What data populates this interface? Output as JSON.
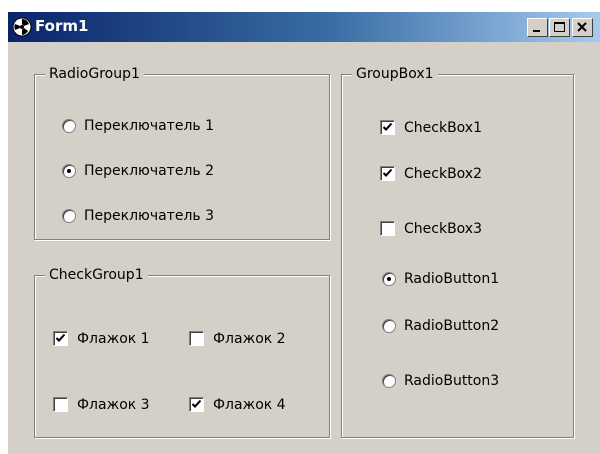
{
  "window": {
    "title": "Form1",
    "icon": "app-icon",
    "controls": [
      "minimize-icon",
      "maximize-icon",
      "close-icon"
    ]
  },
  "radio_group": {
    "caption": "RadioGroup1",
    "items": [
      {
        "label": "Переключатель 1",
        "checked": false
      },
      {
        "label": "Переключатель 2",
        "checked": true
      },
      {
        "label": "Переключатель 3",
        "checked": false
      }
    ]
  },
  "check_group": {
    "caption": "CheckGroup1",
    "items": [
      {
        "label": "Флажок 1",
        "checked": true
      },
      {
        "label": "Флажок 2",
        "checked": false
      },
      {
        "label": "Флажок 3",
        "checked": false
      },
      {
        "label": "Флажок 4",
        "checked": true
      }
    ]
  },
  "group_box": {
    "caption": "GroupBox1",
    "checkboxes": [
      {
        "label": "CheckBox1",
        "checked": true
      },
      {
        "label": "CheckBox2",
        "checked": true
      },
      {
        "label": "CheckBox3",
        "checked": false
      }
    ],
    "radios": [
      {
        "label": "RadioButton1",
        "checked": true
      },
      {
        "label": "RadioButton2",
        "checked": false
      },
      {
        "label": "RadioButton3",
        "checked": false
      }
    ]
  },
  "colors": {
    "face": "#d4d0c8",
    "title_start": "#0a246a",
    "title_end": "#a6caf0"
  }
}
